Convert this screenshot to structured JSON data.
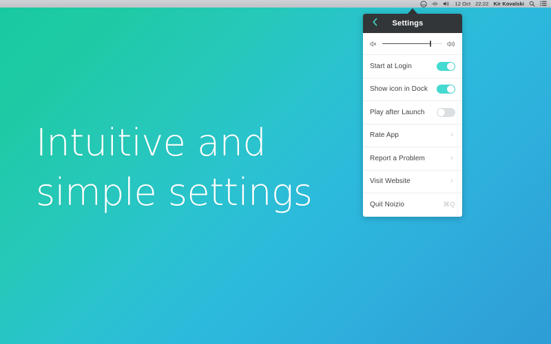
{
  "desktop": {
    "background_from": "#18c9a0",
    "background_to": "#2e9ed6",
    "headline_line1": "Intuitive and",
    "headline_line2": "simple settings"
  },
  "menubar": {
    "background": "#c6c9ce",
    "items": [
      {
        "type": "icon",
        "name": "noizio-status-icon",
        "label": "noizio-status-icon"
      },
      {
        "type": "icon",
        "name": "airplay-icon",
        "label": "airplay-icon"
      },
      {
        "type": "icon",
        "name": "volume-icon",
        "label": "volume-icon"
      },
      {
        "type": "text",
        "name": "menubar-date",
        "label": "12 Oct"
      },
      {
        "type": "text",
        "name": "menubar-time",
        "label": "22:22"
      },
      {
        "type": "text",
        "name": "menubar-user",
        "label": "Kir Kovalski"
      },
      {
        "type": "icon",
        "name": "search-icon",
        "label": "search-icon"
      },
      {
        "type": "icon",
        "name": "notification-center-icon",
        "label": "notification-center-icon"
      }
    ],
    "date": "12 Oct",
    "time": "22:22",
    "user": "Kir Kovalski"
  },
  "popover": {
    "header": {
      "title": "Settings",
      "back_icon": "chevron-left-icon",
      "background": "#333638",
      "accent": "#44d9d1"
    },
    "volume": {
      "mute_icon": "volume-mute-icon",
      "max_icon": "volume-up-icon",
      "value_percent": 80
    },
    "toggles": [
      {
        "label": "Start at Login",
        "on": true
      },
      {
        "label": "Show icon in Dock",
        "on": true
      },
      {
        "label": "Play after Launch",
        "on": false
      }
    ],
    "links": [
      {
        "label": "Rate App",
        "chevron": "›"
      },
      {
        "label": "Report a Problem",
        "chevron": "›"
      },
      {
        "label": "Visit Website",
        "chevron": "›"
      }
    ],
    "quit": {
      "label": "Quit Noizio",
      "shortcut": "⌘Q"
    },
    "toggle_on_color": "#44d9d1",
    "toggle_off_color": "#dcdfe1"
  }
}
